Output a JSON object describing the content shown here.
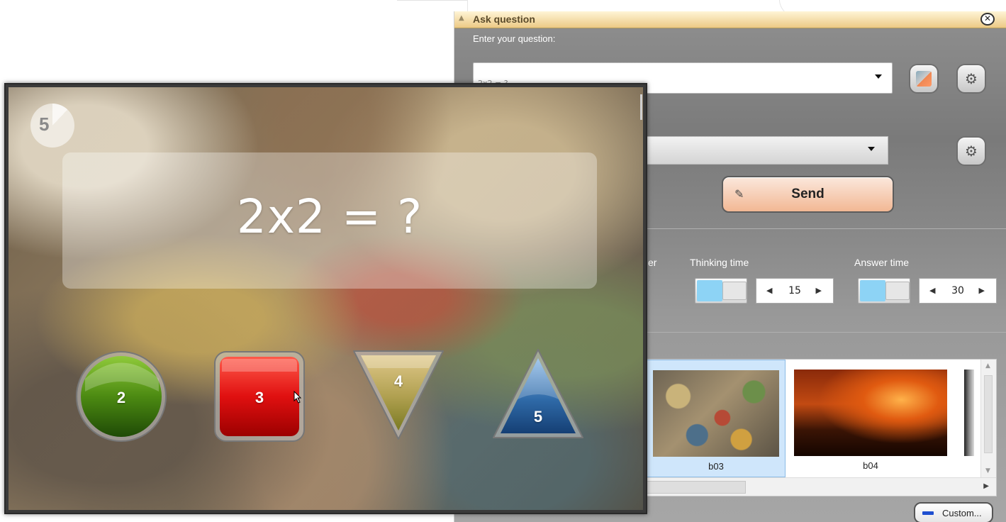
{
  "ask_window": {
    "title": "Ask question",
    "prompt_label": "Enter your question:",
    "question_value": "2x2 = ?",
    "send_label": "Send",
    "partial_label": "er",
    "thinking_time": {
      "label": "Thinking time",
      "value": "15"
    },
    "answer_time": {
      "label": "Answer time",
      "value": "30"
    },
    "gallery": [
      {
        "caption": "b03",
        "selected": true
      },
      {
        "caption": "b04",
        "selected": false
      }
    ],
    "custom_label": "Custom..."
  },
  "quiz": {
    "timer": "5",
    "question": "2x2 = ?",
    "answers": [
      {
        "label": "2",
        "shape": "circle",
        "color": "#4c8a12"
      },
      {
        "label": "3",
        "shape": "square",
        "color": "#e01010"
      },
      {
        "label": "4",
        "shape": "triangle-down",
        "color": "#a49a3e"
      },
      {
        "label": "5",
        "shape": "triangle-up",
        "color": "#2f6aa8"
      }
    ]
  },
  "icons": {
    "close": "close-icon",
    "favorites": "favorites-icon",
    "settings": "gear-icon",
    "send": "send-icon",
    "cursor": "mouse-pointer-icon"
  },
  "colors": {
    "title_bar": "#ecc985",
    "send_button": "#f2b894",
    "toggle_on": "#8dd3f5",
    "selection": "#cfe6fb"
  }
}
